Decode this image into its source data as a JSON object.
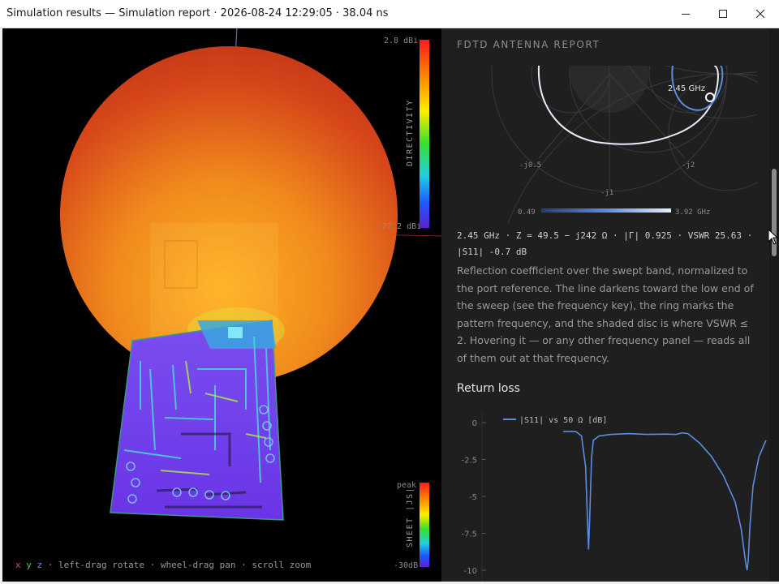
{
  "window": {
    "title": "Simulation results — Simulation report · 2026-08-24 12:29:05 · 38.04 ns",
    "controls": [
      "minimize",
      "maximize",
      "close"
    ]
  },
  "viewport": {
    "directivity_scale": {
      "max_label": "2.8 dBi",
      "min_label": "-27.2 dBi",
      "axis_title": "DIRECTIVITY"
    },
    "sheet_scale": {
      "max_label": "peak",
      "min_label": "-30dB",
      "axis_title": "SHEET |JS|"
    },
    "axes": {
      "x": "x",
      "y": "y",
      "z": "z"
    },
    "hint": "·  left-drag rotate · wheel-drag pan · scroll zoom"
  },
  "report": {
    "heading": "FDTD ANTENNA REPORT",
    "smith": {
      "labels": {
        "freq_marker": "2.45 GHz",
        "neg_j05": "-j0.5",
        "neg_j2": "-j2",
        "neg_j1": "-j1"
      },
      "freq_key": {
        "min": "0.49",
        "max": "3.92 GHz"
      },
      "icons": [
        "marker-ring-icon"
      ]
    },
    "readout": "2.45 GHz · Z = 49.5 − j242 Ω · |Γ| 0.925 · VSWR 25.63 · |S11| -0.7 dB",
    "description": "Reflection coefficient over the swept band, normalized to the port reference. The line darkens toward the low end of the sweep (see the frequency key), the ring marks the pattern frequency, and the shaded disc is where VSWR ≤ 2. Hovering it — or any other frequency panel — reads all of them out at that frequency.",
    "return_loss": {
      "title": "Return loss",
      "legend": "|S11| vs 50 Ω [dB]",
      "yticks": [
        "0",
        "-2.5",
        "-5",
        "-7.5",
        "-10"
      ]
    }
  },
  "chart_data": {
    "type": "line",
    "title": "Return loss",
    "xlabel": "",
    "ylabel": "",
    "x": [
      0.49,
      0.6,
      0.7,
      0.8,
      0.87,
      0.9,
      0.92,
      0.94,
      0.97,
      1.0,
      1.1,
      1.3,
      1.6,
      1.9,
      2.2,
      2.4,
      2.5,
      2.6,
      2.8,
      3.0,
      3.2,
      3.4,
      3.5,
      3.58,
      3.6,
      3.62,
      3.65,
      3.7,
      3.8,
      3.92
    ],
    "series": [
      {
        "name": "|S11| vs 50 Ω [dB]",
        "values": [
          -0.6,
          -0.6,
          -0.6,
          -0.9,
          -3.0,
          -6.5,
          -8.6,
          -6.3,
          -2.4,
          -1.2,
          -0.9,
          -0.8,
          -0.75,
          -0.8,
          -0.78,
          -0.8,
          -0.7,
          -0.75,
          -1.4,
          -2.3,
          -3.6,
          -5.4,
          -7.2,
          -9.6,
          -10.0,
          -9.3,
          -6.9,
          -4.3,
          -2.3,
          -1.2
        ],
        "color": "#5b8de0"
      }
    ],
    "ylim": [
      -10,
      0
    ],
    "yticks": [
      0,
      -2.5,
      -5,
      -7.5,
      -10
    ],
    "grid": false,
    "legend": "top-left"
  },
  "colors": {
    "accent": "#5b8de0",
    "panel_bg": "#1f1f1f",
    "viewport_bg": "#000000"
  }
}
